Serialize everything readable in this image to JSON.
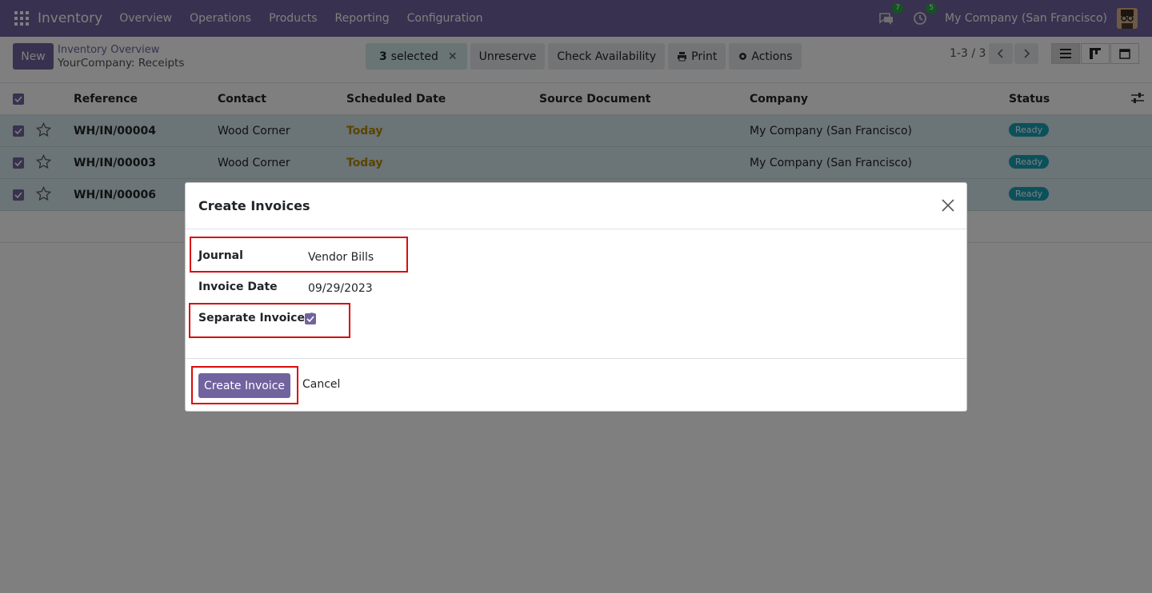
{
  "navbar": {
    "app_name": "Inventory",
    "menu": [
      "Overview",
      "Operations",
      "Products",
      "Reporting",
      "Configuration"
    ],
    "messages_count": "7",
    "activities_count": "5",
    "company": "My Company (San Francisco)"
  },
  "control_panel": {
    "new_label": "New",
    "breadcrumb_parent": "Inventory Overview",
    "breadcrumb_current": "YourCompany: Receipts",
    "selected_count": "3",
    "selected_label": "selected",
    "unreserve_label": "Unreserve",
    "check_availability_label": "Check Availability",
    "print_label": "Print",
    "actions_label": "Actions",
    "pager": "1-3 / 3"
  },
  "list": {
    "columns": [
      "Reference",
      "Contact",
      "Scheduled Date",
      "Source Document",
      "Company",
      "Status"
    ],
    "rows": [
      {
        "reference": "WH/IN/00004",
        "contact": "Wood Corner",
        "date": "Today",
        "company": "My Company (San Francisco)",
        "status": "Ready"
      },
      {
        "reference": "WH/IN/00003",
        "contact": "Wood Corner",
        "date": "Today",
        "company": "My Company (San Francisco)",
        "status": "Ready"
      },
      {
        "reference": "WH/IN/00006",
        "contact": "",
        "date": "",
        "company": "",
        "status": "Ready"
      }
    ]
  },
  "dialog": {
    "title": "Create Invoices",
    "journal_label": "Journal",
    "journal_value": "Vendor Bills",
    "invoice_date_label": "Invoice Date",
    "invoice_date_value": "09/29/2023",
    "separate_invoice_label": "Separate Invoice ?",
    "separate_invoice_checked": true,
    "create_label": "Create Invoice",
    "cancel_label": "Cancel"
  },
  "colors": {
    "brand": "#71639e",
    "highlight_box": "#d90d0d",
    "row_selected": "#d7e9ec",
    "status_ready": "#17a2b8",
    "today": "#b38a00"
  }
}
